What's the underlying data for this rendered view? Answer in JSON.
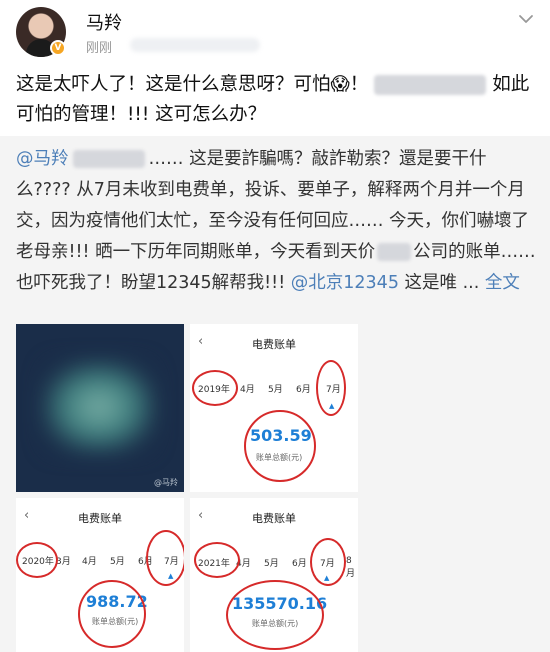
{
  "post": {
    "username": "马羚",
    "timestamp": "刚刚",
    "text_part1": "这是太吓人了！这是什么意思呀？可怕😱！",
    "text_part2": "如此可怕的管理！!!! 这可怎么办？"
  },
  "repost": {
    "mention": "@马羚",
    "text1": "…… 这是要詐騙嗎？敲詐勒索？還是要干什么???? 从7月未收到电费单，投诉、要单子，解释两个月并一个月交，因为疫情他们太忙，至今没有任何回应…… 今天，你们嚇壞了老母亲!!! 晒一下历年同期账单，今天看到天价",
    "text2": "公司的账单……也吓死我了！盼望12345解帮我!!! ",
    "mention2": "@北京12345",
    "text3": " 这是唯 ... ",
    "expand": "全文"
  },
  "images": {
    "watermark": "@马羚",
    "bills": [
      {
        "title": "电费账单",
        "back": "‹",
        "year": "2019年",
        "months": [
          "4月",
          "5月",
          "6月",
          "7月"
        ],
        "amount": "503.59",
        "caption": "账单总额(元)"
      },
      {
        "title": "电费账单",
        "back": "‹",
        "year": "2020年",
        "months": [
          "3月",
          "4月",
          "5月",
          "6月",
          "7月"
        ],
        "amount": "988.72",
        "caption": "账单总额(元)"
      },
      {
        "title": "电费账单",
        "back": "‹",
        "year": "2021年",
        "months": [
          "4月",
          "5月",
          "6月",
          "7月",
          "8月"
        ],
        "amount": "135570.16",
        "caption": "账单总额(元)"
      }
    ]
  },
  "colors": {
    "link": "#4d7fb8",
    "amount": "#1e7fd6",
    "circle": "#d62a2a",
    "repost_bg": "#f4f4f4"
  }
}
